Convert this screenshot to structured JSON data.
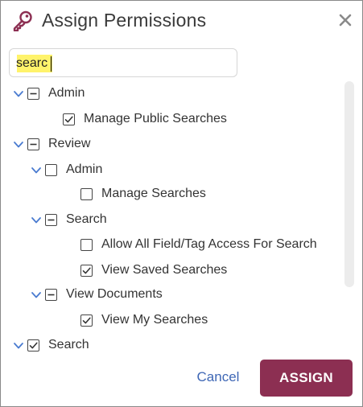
{
  "dialog": {
    "title": "Assign Permissions",
    "title_icon": "key-icon",
    "close_icon": "close-icon",
    "accent_color": "#8c2f52",
    "link_color": "#3e67b5"
  },
  "search": {
    "value": "searc",
    "highlight_color": "#fff36b"
  },
  "tree": [
    {
      "label": "Admin",
      "level": 0,
      "expanded": true,
      "state": "partial"
    },
    {
      "label": "Manage Public Searches",
      "level": 1,
      "expanded": null,
      "state": "checked"
    },
    {
      "label": "Review",
      "level": 0,
      "expanded": true,
      "state": "partial"
    },
    {
      "label": "Admin",
      "level": 1,
      "expanded": true,
      "state": "unchecked"
    },
    {
      "label": "Manage Searches",
      "level": 2,
      "expanded": null,
      "state": "unchecked"
    },
    {
      "label": "Search",
      "level": 1,
      "expanded": true,
      "state": "partial"
    },
    {
      "label": "Allow All Field/Tag Access For Search",
      "level": 2,
      "expanded": null,
      "state": "unchecked"
    },
    {
      "label": "View Saved Searches",
      "level": 2,
      "expanded": null,
      "state": "checked"
    },
    {
      "label": "View Documents",
      "level": 1,
      "expanded": true,
      "state": "partial"
    },
    {
      "label": "View My Searches",
      "level": 2,
      "expanded": null,
      "state": "checked"
    },
    {
      "label": "Search",
      "level": 0,
      "expanded": true,
      "state": "checked"
    }
  ],
  "footer": {
    "cancel_label": "Cancel",
    "assign_label": "ASSIGN"
  }
}
